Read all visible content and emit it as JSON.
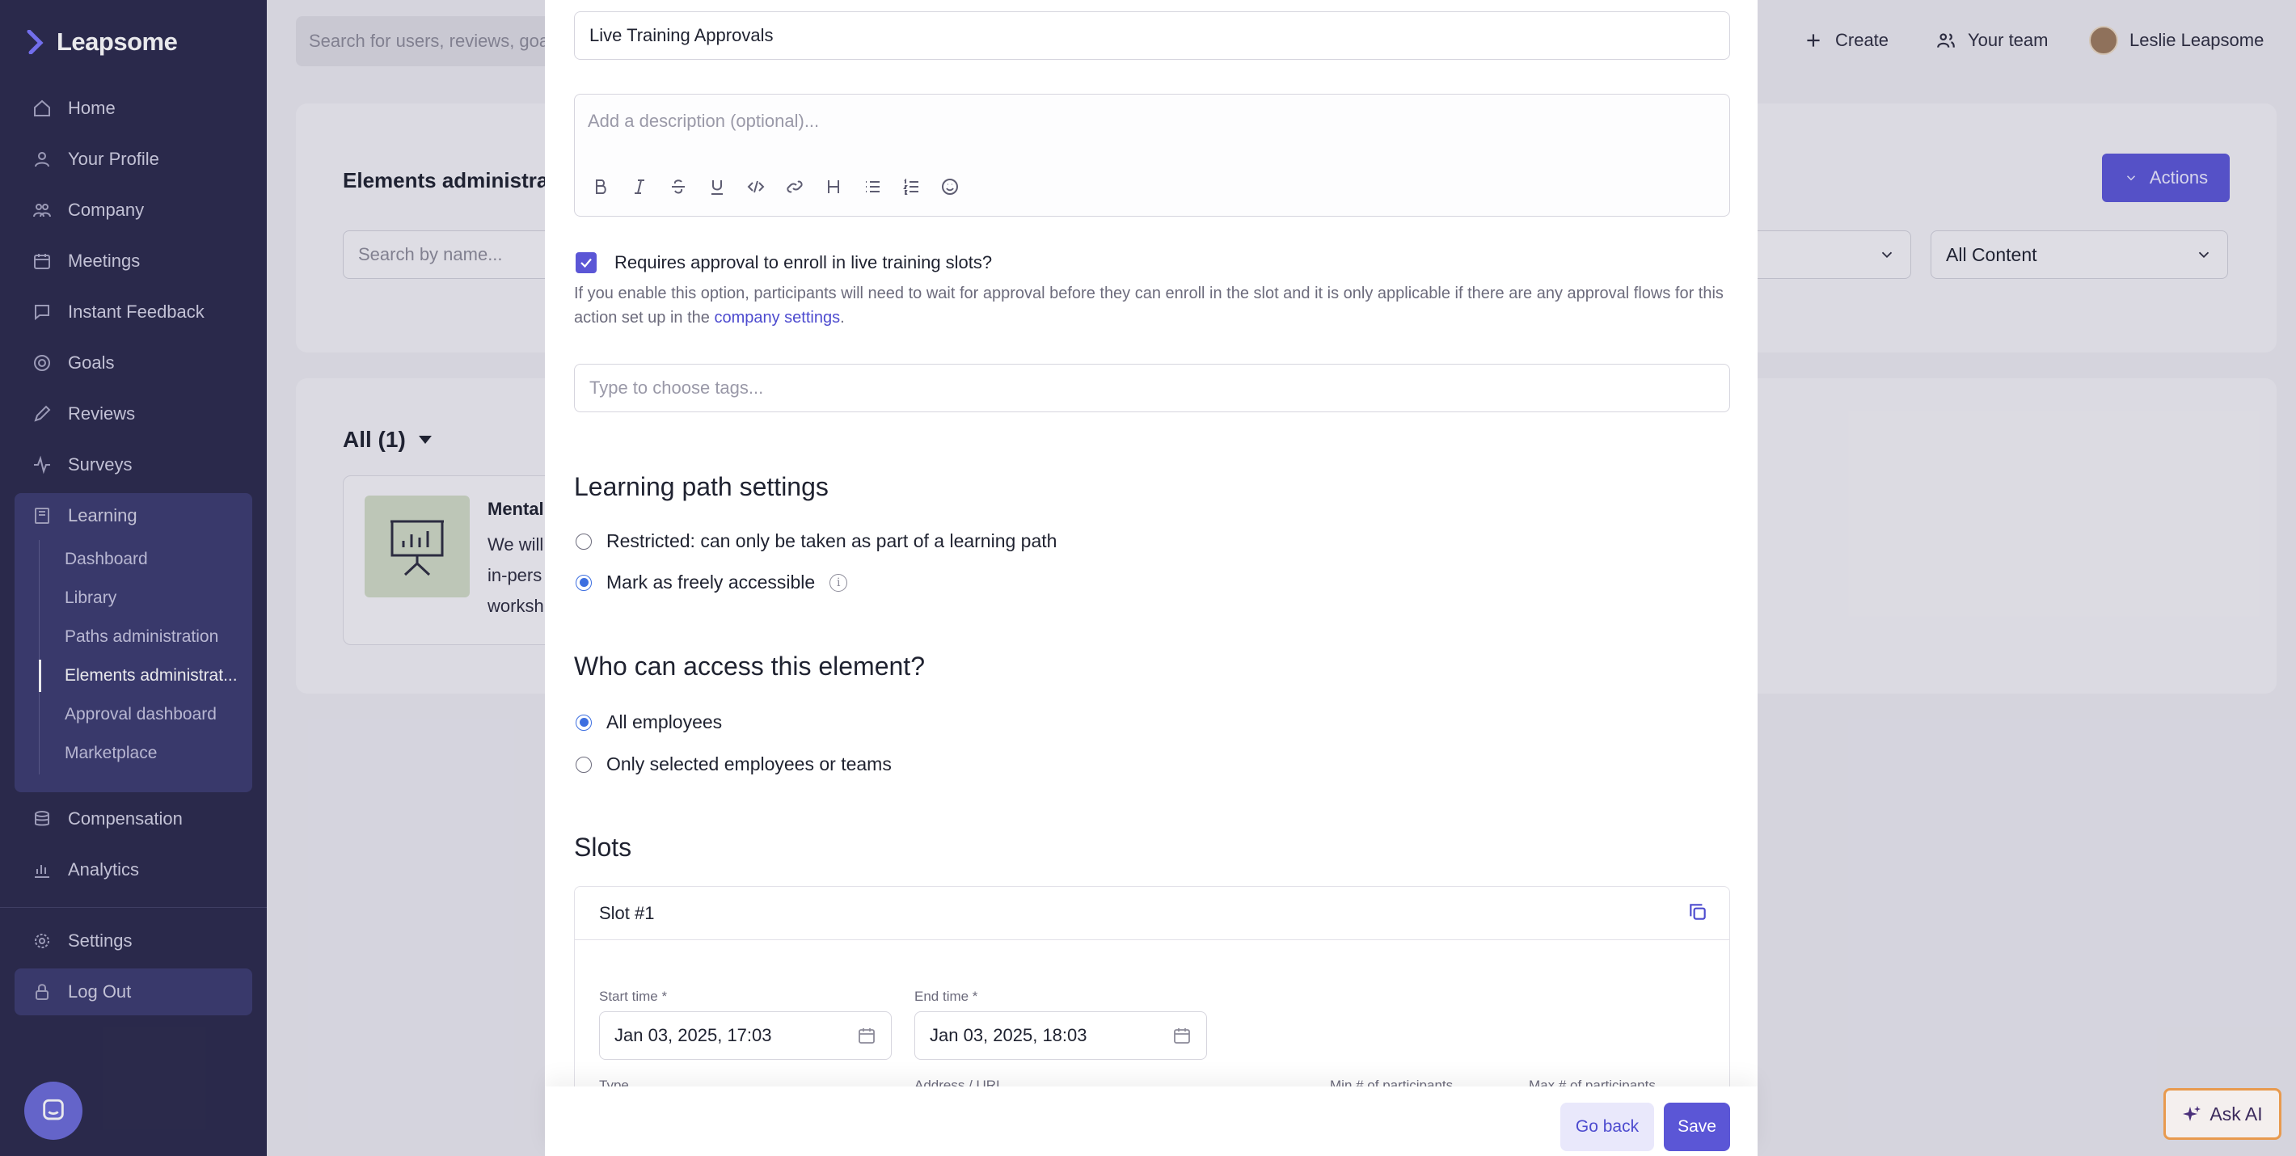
{
  "app": {
    "brand": "Leapsome"
  },
  "sidebar": {
    "items": [
      {
        "label": "Home",
        "icon": "home-icon"
      },
      {
        "label": "Your Profile",
        "icon": "user-icon"
      },
      {
        "label": "Company",
        "icon": "company-icon"
      },
      {
        "label": "Meetings",
        "icon": "calendar-icon"
      },
      {
        "label": "Instant Feedback",
        "icon": "feedback-icon"
      },
      {
        "label": "Goals",
        "icon": "target-icon"
      },
      {
        "label": "Reviews",
        "icon": "pencil-icon"
      },
      {
        "label": "Surveys",
        "icon": "pulse-icon"
      },
      {
        "label": "Learning",
        "icon": "book-icon"
      }
    ],
    "learning_sub": [
      "Dashboard",
      "Library",
      "Paths administration",
      "Elements administrat...",
      "Approval dashboard",
      "Marketplace"
    ],
    "items_bottom": [
      {
        "label": "Compensation",
        "icon": "coins-icon"
      },
      {
        "label": "Analytics",
        "icon": "chart-icon"
      }
    ],
    "settings": "Settings",
    "logout": "Log Out"
  },
  "topbar": {
    "search_placeholder": "Search for users, reviews, goa",
    "create": "Create",
    "your_team": "Your team",
    "user_name": "Leslie Leapsome"
  },
  "background": {
    "page_title": "Elements administra",
    "search_placeholder": "Search by name...",
    "actions": "Actions",
    "filter_content": "All Content",
    "all_count": "All (1)",
    "card_title": "Mental",
    "card_lines": [
      "We will",
      "in-pers",
      "worksh"
    ]
  },
  "modal": {
    "title_value": "Live Training Approvals",
    "description_placeholder": "Add a description (optional)...",
    "approval_checkbox_label": "Requires approval to enroll in live training slots?",
    "approval_checked": true,
    "help_text_before": "If you enable this option, participants will need to wait for approval before they can enroll in the slot and it is only applicable if there are any approval flows for this action set up in the ",
    "help_link": "company settings",
    "help_text_after": ".",
    "tags_placeholder": "Type to choose tags...",
    "learning_path_heading": "Learning path settings",
    "lp_option_restricted": "Restricted: can only be taken as part of a learning path",
    "lp_option_free": "Mark as freely accessible",
    "lp_selected": "free",
    "access_heading": "Who can access this element?",
    "access_all": "All employees",
    "access_selected": "Only selected employees or teams",
    "access_choice": "all",
    "slots_heading": "Slots",
    "slot_title": "Slot #1",
    "start_label": "Start time *",
    "start_value": "Jan 03, 2025, 17:03",
    "end_label": "End time *",
    "end_value": "Jan 03, 2025, 18:03",
    "type_label": "Type",
    "address_label": "Address / URL",
    "min_label": "Min # of participants",
    "max_label": "Max # of participants",
    "go_back": "Go back",
    "save": "Save"
  },
  "ask_ai": "Ask AI",
  "colors": {
    "accent": "#5b56d6",
    "sidebar": "#2b2a4c",
    "link": "#4d4bcf"
  }
}
